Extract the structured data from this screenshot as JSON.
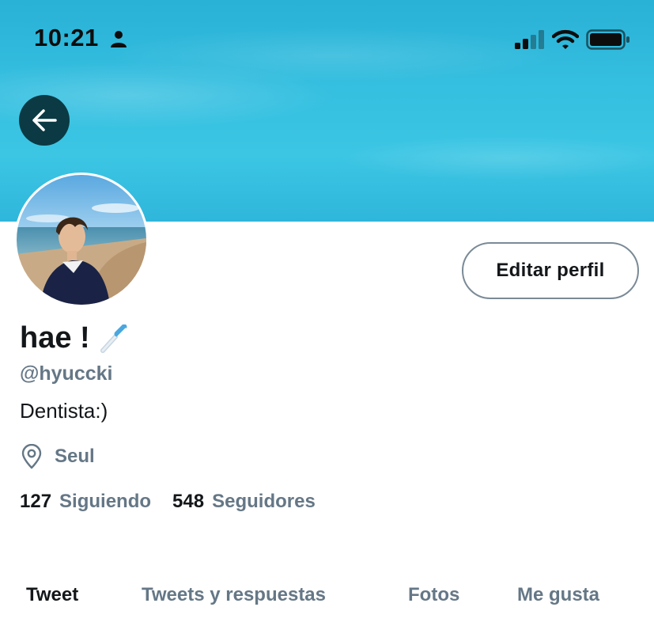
{
  "status_bar": {
    "time": "10:21"
  },
  "colors": {
    "banner": "#35bfe0",
    "back_button_bg": "#0b3a44",
    "secondary_text": "#657786",
    "primary_text": "#14171a"
  },
  "header": {
    "back_icon": "arrow-left-icon"
  },
  "profile": {
    "display_name": "hae !",
    "name_emoji": "toothbrush-icon",
    "handle": "@hyuccki",
    "bio": "Dentista:)",
    "location_icon": "location-pin-icon",
    "location": "Seul",
    "edit_button_label": "Editar perfil"
  },
  "stats": {
    "following_count": "127",
    "following_label": "Siguiendo",
    "followers_count": "548",
    "followers_label": "Seguidores"
  },
  "tabs": [
    {
      "label": "Tweet",
      "active": true
    },
    {
      "label": "Tweets y respuestas",
      "active": false
    },
    {
      "label": "Fotos",
      "active": false
    },
    {
      "label": "Me gusta",
      "active": false
    }
  ]
}
